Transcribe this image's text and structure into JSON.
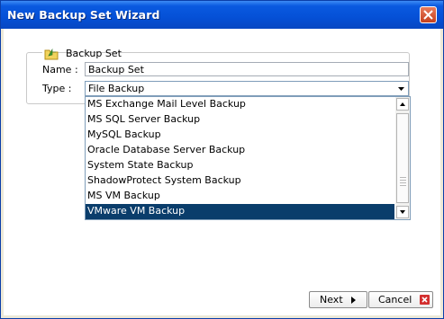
{
  "window": {
    "title": "New Backup Set Wizard"
  },
  "group": {
    "legend": "Backup Set",
    "icon": "folder-arrow-icon"
  },
  "name_row": {
    "label": "Name :",
    "value": "Backup Set"
  },
  "type_row": {
    "label": "Type :",
    "value": "File Backup"
  },
  "dropdown": {
    "items": [
      "MS Exchange Mail Level Backup",
      "MS SQL Server Backup",
      "MySQL Backup",
      "Oracle Database Server Backup",
      "System State Backup",
      "ShadowProtect System Backup",
      "MS VM Backup",
      "VMware VM Backup"
    ],
    "selected_index": 7
  },
  "buttons": {
    "next": "Next",
    "cancel": "Cancel"
  },
  "colors": {
    "title_bar": "#0550d6",
    "selection": "#0a3d6b",
    "close": "#c5401d",
    "cancel_icon": "#d32f2f"
  }
}
